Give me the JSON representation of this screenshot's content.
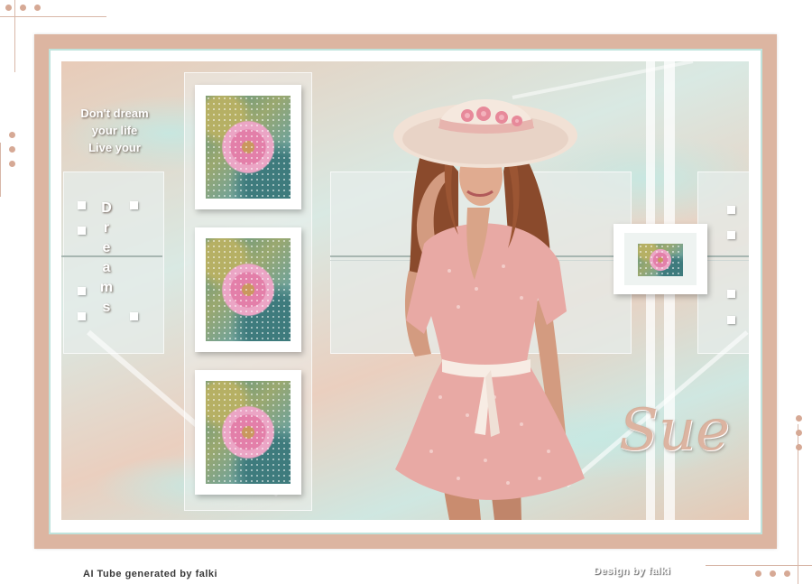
{
  "quote_lines": [
    "Don't dream",
    "your life",
    "Live your"
  ],
  "dreams_letters": [
    "D",
    "r",
    "e",
    "a",
    "m",
    "s"
  ],
  "signature": "Sue",
  "credits": {
    "tube": "AI Tube generated by falki",
    "design": "Design by falki"
  },
  "colors": {
    "frame": "#dcb5a1",
    "mint": "#c5e8e2",
    "dress": "#e3a4a0",
    "flower": "#e37fa9"
  }
}
